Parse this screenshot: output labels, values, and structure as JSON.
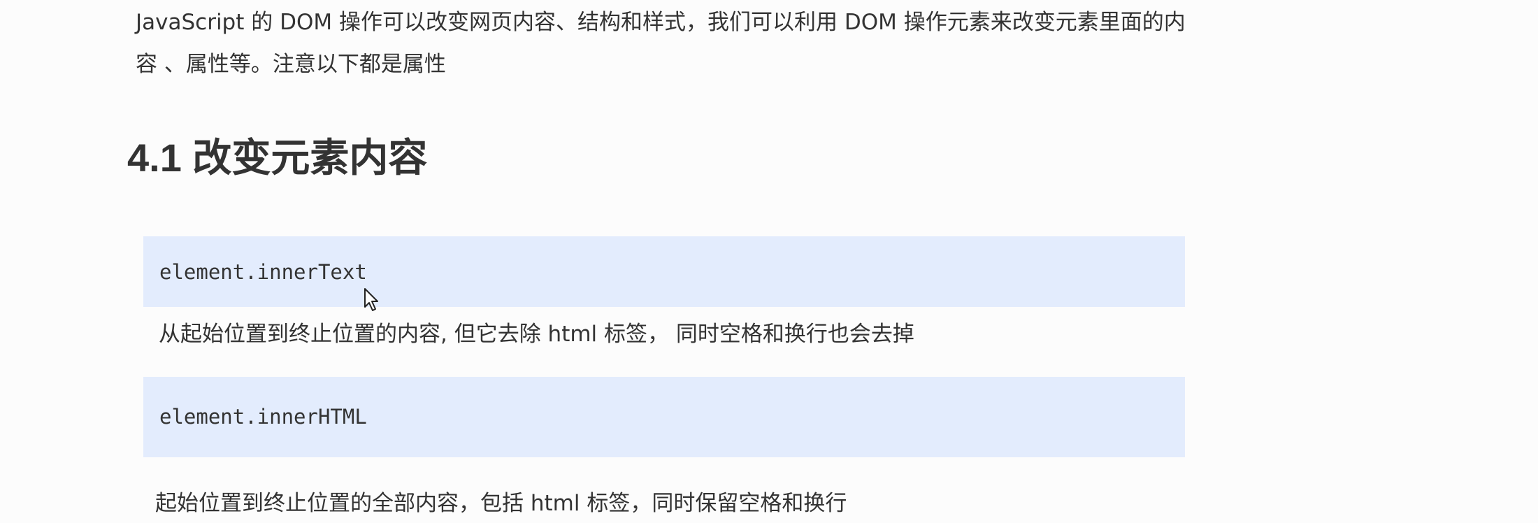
{
  "intro": {
    "line1": "JavaScript 的 DOM 操作可以改变网页内容、结构和样式，我们可以利用 DOM 操作元素来改变元素里面的内",
    "line2": "容 、属性等。注意以下都是属性"
  },
  "section": {
    "heading": "4.1 改变元素内容"
  },
  "items": [
    {
      "code": "element.innerText",
      "description": "从起始位置到终止位置的内容, 但它去除 html 标签， 同时空格和换行也会去掉"
    },
    {
      "code": "element.innerHTML",
      "description": "起始位置到终止位置的全部内容，包括 html 标签，同时保留空格和换行"
    }
  ],
  "colors": {
    "code_background": "#e3ecfd",
    "text": "#333333",
    "page_background": "#fcfcfc"
  },
  "icons": {
    "cursor": "mouse-pointer-icon"
  }
}
